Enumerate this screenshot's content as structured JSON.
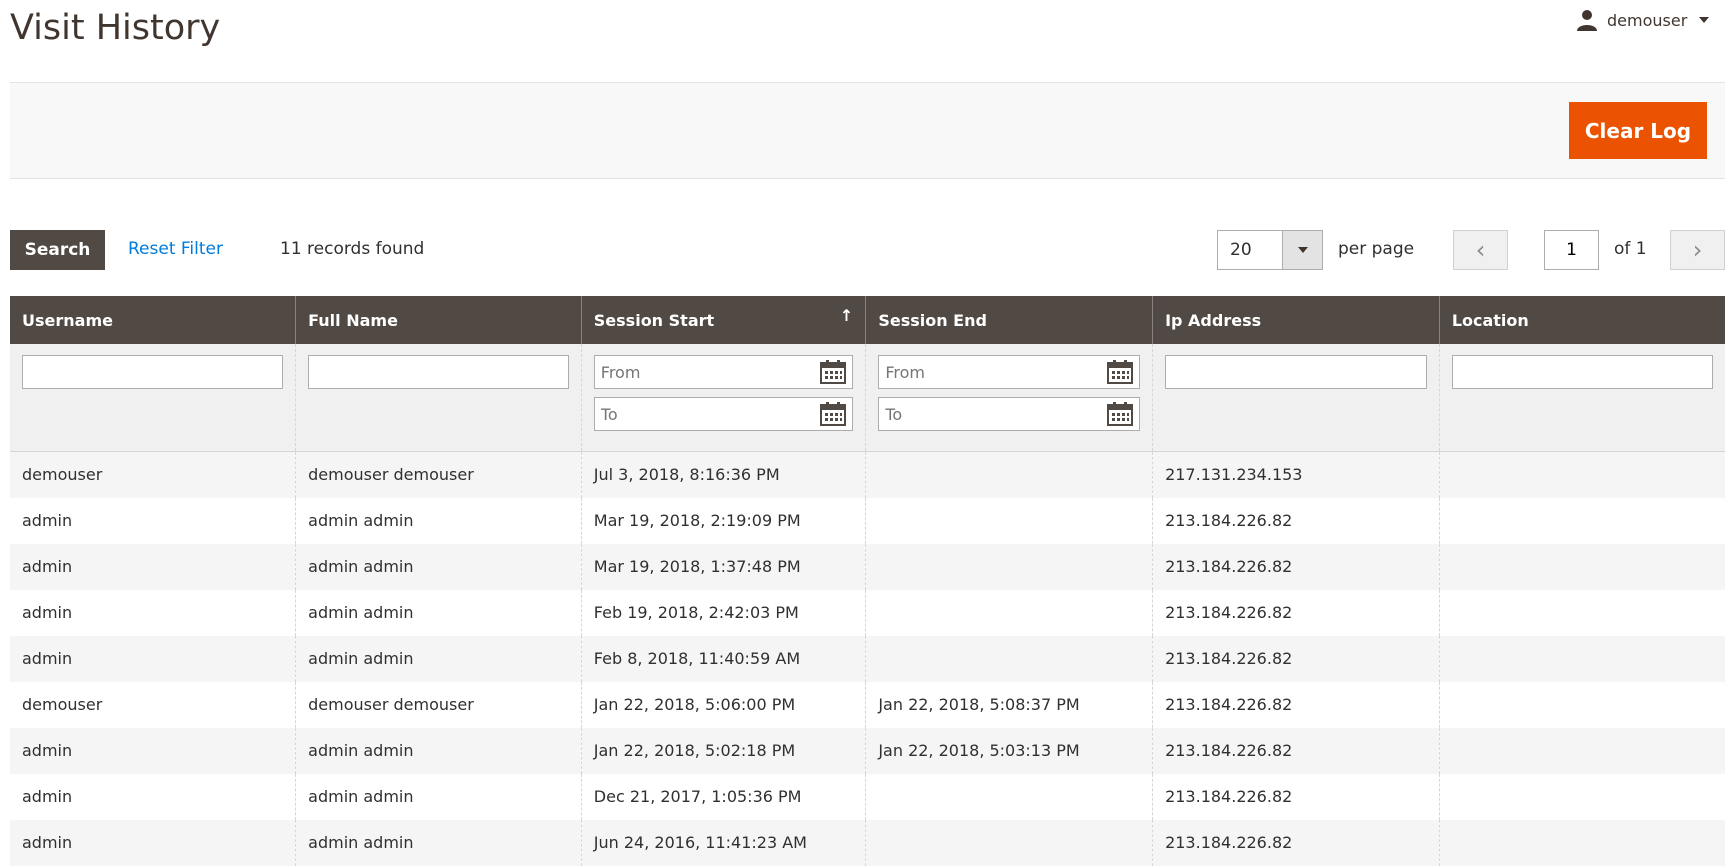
{
  "header": {
    "title": "Visit History",
    "user_name": "demouser"
  },
  "actions": {
    "clear_log_label": "Clear Log"
  },
  "toolbar": {
    "search_label": "Search",
    "reset_filter_label": "Reset Filter",
    "records_found": "11 records found",
    "per_page_value": "20",
    "per_page_label": "per page",
    "page_value": "1",
    "page_of": "of 1"
  },
  "grid": {
    "columns": [
      "Username",
      "Full Name",
      "Session Start",
      "Session End",
      "Ip Address",
      "Location"
    ],
    "sorted_column": "Session Start",
    "sort_direction": "ascending",
    "filter_placeholders": {
      "from": "From",
      "to": "To"
    },
    "rows": [
      [
        "demouser",
        "demouser demouser",
        "Jul 3, 2018, 8:16:36 PM",
        "",
        "217.131.234.153",
        ""
      ],
      [
        "admin",
        "admin admin",
        "Mar 19, 2018, 2:19:09 PM",
        "",
        "213.184.226.82",
        ""
      ],
      [
        "admin",
        "admin admin",
        "Mar 19, 2018, 1:37:48 PM",
        "",
        "213.184.226.82",
        ""
      ],
      [
        "admin",
        "admin admin",
        "Feb 19, 2018, 2:42:03 PM",
        "",
        "213.184.226.82",
        ""
      ],
      [
        "admin",
        "admin admin",
        "Feb 8, 2018, 11:40:59 AM",
        "",
        "213.184.226.82",
        ""
      ],
      [
        "demouser",
        "demouser demouser",
        "Jan 22, 2018, 5:06:00 PM",
        "Jan 22, 2018, 5:08:37 PM",
        "213.184.226.82",
        ""
      ],
      [
        "admin",
        "admin admin",
        "Jan 22, 2018, 5:02:18 PM",
        "Jan 22, 2018, 5:03:13 PM",
        "213.184.226.82",
        ""
      ],
      [
        "admin",
        "admin admin",
        "Dec 21, 2017, 1:05:36 PM",
        "",
        "213.184.226.82",
        ""
      ],
      [
        "admin",
        "admin admin",
        "Jun 24, 2016, 11:41:23 AM",
        "",
        "213.184.226.82",
        ""
      ]
    ]
  },
  "colors": {
    "accent": "#eb5202",
    "header_bg": "#514943",
    "link": "#007bdb"
  }
}
